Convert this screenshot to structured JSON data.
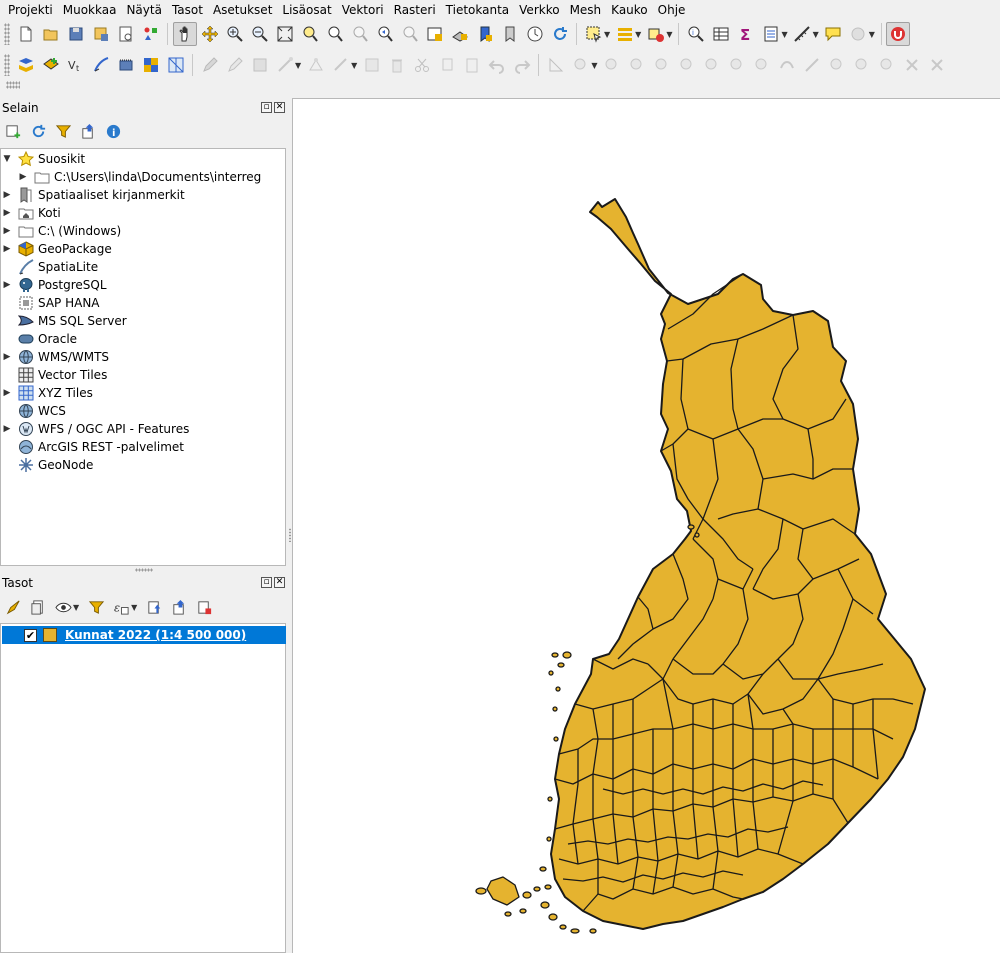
{
  "menu": [
    "Projekti",
    "Muokkaa",
    "Näytä",
    "Tasot",
    "Asetukset",
    "Lisäosat",
    "Vektori",
    "Rasteri",
    "Tietokanta",
    "Verkko",
    "Mesh",
    "Kauko",
    "Ohje"
  ],
  "browser": {
    "title": "Selain",
    "items": [
      {
        "label": "Suosikit",
        "icon": "star-icon",
        "expanded": true
      },
      {
        "label": "C:\\Users\\linda\\Documents\\interreg",
        "icon": "folder-icon"
      },
      {
        "label": "Spatiaaliset kirjanmerkit",
        "icon": "bookmarks-icon"
      },
      {
        "label": "Koti",
        "icon": "home-folder-icon"
      },
      {
        "label": "C:\\ (Windows)",
        "icon": "folder-icon"
      },
      {
        "label": "GeoPackage",
        "icon": "geopackage-icon"
      },
      {
        "label": "SpatiaLite",
        "icon": "spatialite-icon"
      },
      {
        "label": "PostgreSQL",
        "icon": "postgresql-icon"
      },
      {
        "label": "SAP HANA",
        "icon": "sap-hana-icon"
      },
      {
        "label": "MS SQL Server",
        "icon": "mssql-icon"
      },
      {
        "label": "Oracle",
        "icon": "oracle-icon"
      },
      {
        "label": "WMS/WMTS",
        "icon": "globe-icon"
      },
      {
        "label": "Vector Tiles",
        "icon": "vector-tiles-icon"
      },
      {
        "label": "XYZ Tiles",
        "icon": "xyz-tiles-icon"
      },
      {
        "label": "WCS",
        "icon": "globe-icon"
      },
      {
        "label": "WFS / OGC API - Features",
        "icon": "globe-icon"
      },
      {
        "label": "ArcGIS REST -palvelimet",
        "icon": "arcgis-icon"
      },
      {
        "label": "GeoNode",
        "icon": "geonode-icon"
      }
    ]
  },
  "layers": {
    "title": "Tasot",
    "items": [
      {
        "label": "Kunnat 2022 (1:4 500 000)",
        "checked": true,
        "color": "#e5b32f",
        "selected": true
      }
    ]
  },
  "map": {
    "fill_color": "#e5b32f",
    "stroke_color": "#1a1a1a"
  }
}
